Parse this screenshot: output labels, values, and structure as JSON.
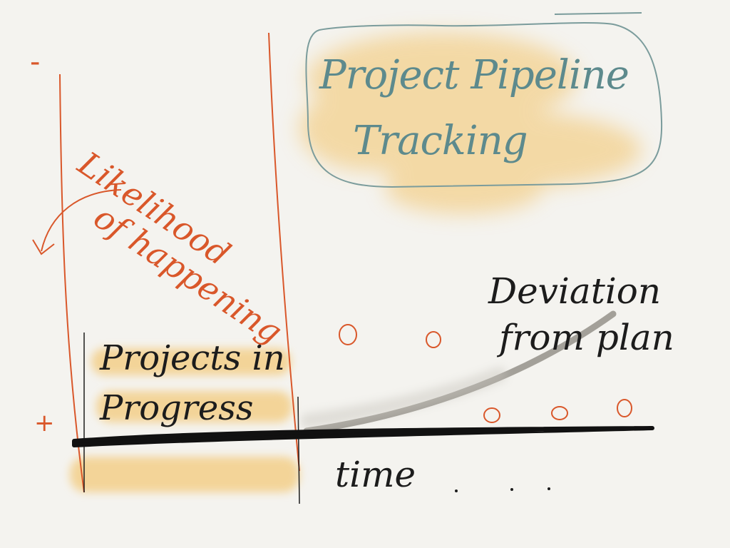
{
  "title": {
    "line1": "Project Pipeline",
    "line2": "Tracking"
  },
  "y_axis_label": {
    "line1": "Likelihood",
    "line2": "of happening"
  },
  "y_axis_ends": {
    "top": "-",
    "bottom": "+"
  },
  "box_label": {
    "line1": "Projects in",
    "line2": "Progress"
  },
  "deviation_label": {
    "line1": "Deviation",
    "line2": "from plan"
  },
  "x_axis_label": "time",
  "colors": {
    "background": "#f4f3ef",
    "ink_orange": "#d9572a",
    "ink_teal": "#5d8a8d",
    "ink_black": "#1c1c1c",
    "highlight_yellow": "#f3c46a",
    "smudge_gray": "#9a978f"
  }
}
